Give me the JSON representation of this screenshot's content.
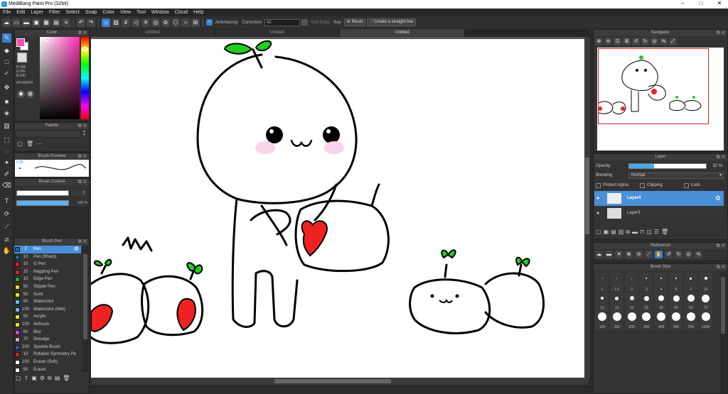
{
  "window": {
    "title": "MediBang Paint Pro (32bit)",
    "minimize": "–",
    "maximize": "□",
    "close": "✕"
  },
  "menu": [
    "File",
    "Edit",
    "Layer",
    "Filter",
    "Select",
    "Snap",
    "Color",
    "View",
    "Tool",
    "Window",
    "Cloud",
    "Help"
  ],
  "toolbar": {
    "antialiasing": "AntiAliasing",
    "correction_label": "Correction",
    "correction_value": "42",
    "soft_edge": "Soft Edge",
    "key_label": "Key",
    "reset": "Reset",
    "straight_line": "Create a straight line"
  },
  "color_panel": {
    "title": "Color",
    "r": "R:346",
    "g": "G:0%",
    "b": "B:240",
    "hex": "#FF48FF0"
  },
  "palette_panel": {
    "title": "Palette"
  },
  "brush_preview": {
    "title": "Brush Preview",
    "size": "0.35"
  },
  "brush_control": {
    "title": "Brush Control",
    "size_value": "2",
    "opacity_value": "100 %"
  },
  "brush_panel": {
    "title": "Brush Pen",
    "items": [
      {
        "size": "2",
        "name": "Pen",
        "color": "#2a5fa8",
        "selected": true
      },
      {
        "size": "10",
        "name": "Pen (Sharp)",
        "color": "#2a5fa8"
      },
      {
        "size": "15",
        "name": "G Pen",
        "color": "#e02020"
      },
      {
        "size": "15",
        "name": "Mapping Pen",
        "color": "#e02020"
      },
      {
        "size": "10",
        "name": "Edge Pen",
        "color": "#20b020"
      },
      {
        "size": "50",
        "name": "Stipple Pen",
        "color": "#e8e020"
      },
      {
        "size": "50",
        "name": "Sumi",
        "color": "#e8e020"
      },
      {
        "size": "50",
        "name": "Watercolor",
        "color": "#60c0f0"
      },
      {
        "size": "100",
        "name": "Watercolor (Wet)",
        "color": "#60c0f0"
      },
      {
        "size": "50",
        "name": "Acrylic",
        "color": "#e8e020"
      },
      {
        "size": "100",
        "name": "Airbrush",
        "color": "#e8e020"
      },
      {
        "size": "50",
        "name": "Blur",
        "color": "#e040e0"
      },
      {
        "size": "70",
        "name": "Smudge",
        "color": "#f0a0d0"
      },
      {
        "size": "100",
        "name": "Sparkle Brush",
        "color": "#2a5fa8"
      },
      {
        "size": "10",
        "name": "Rotation Symmetry Pe",
        "color": "#e02020"
      },
      {
        "size": "100",
        "name": "Eraser (Soft)",
        "color": "#ffffff"
      },
      {
        "size": "50",
        "name": "Eraser",
        "color": "#ffffff"
      }
    ]
  },
  "tabs": [
    "Untitled",
    "Untitled",
    "Untitled"
  ],
  "navigator": {
    "title": "Navigator"
  },
  "layer_panel": {
    "title": "Layer",
    "opacity_label": "Opacity",
    "opacity_value": "32 %",
    "opacity_fraction": 0.32,
    "blending_label": "Blending",
    "blending_value": "Normal",
    "protect_alpha": "Protect Alpha",
    "clipping": "Clipping",
    "lock": "Lock",
    "layers": [
      {
        "name": "Layer4",
        "selected": true
      },
      {
        "name": "Layer3",
        "selected": false
      }
    ]
  },
  "reference_panel": {
    "title": "Reference"
  },
  "brush_size_panel": {
    "title": "Brush Size",
    "row1": [
      "1",
      "1.5",
      "2",
      "3",
      "4",
      "5",
      "7",
      "10"
    ],
    "row2": [
      "12",
      "15",
      "20",
      "25",
      "30",
      "40",
      "50",
      "70"
    ],
    "row3": [
      "100",
      "150",
      "200",
      "300",
      "400",
      "500",
      "700",
      "1000"
    ]
  }
}
